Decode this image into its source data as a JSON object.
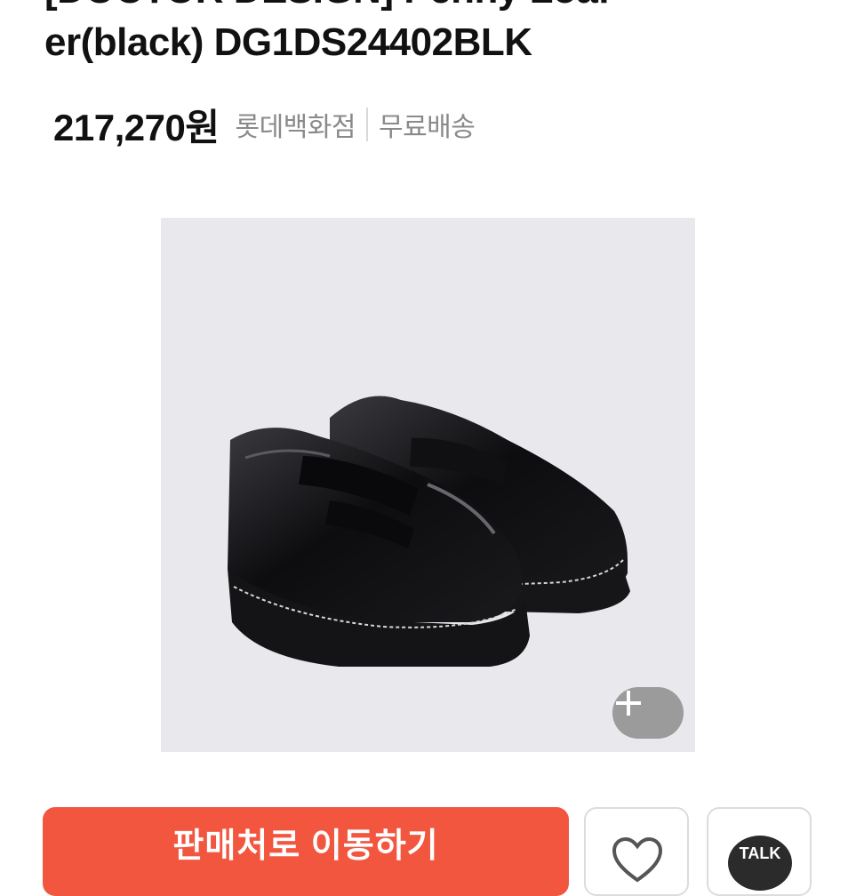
{
  "product": {
    "title_line1": "[DOCTOR DESIGN] Penny Loaf",
    "title_line2": "er(black) DG1DS24402BLK",
    "price": "217,270원",
    "seller": "롯데백화점",
    "shipping": "무료배송"
  },
  "image": {
    "subject": "black penny loafers",
    "zoom_icon": "plus-icon",
    "background_color": "#e9e8ed"
  },
  "actions": {
    "buy_label": "판매처로 이동하기",
    "like_icon": "heart-icon",
    "talk_label": "TALK"
  },
  "colors": {
    "accent": "#f2563f",
    "meta_text": "#8a8a8a"
  }
}
